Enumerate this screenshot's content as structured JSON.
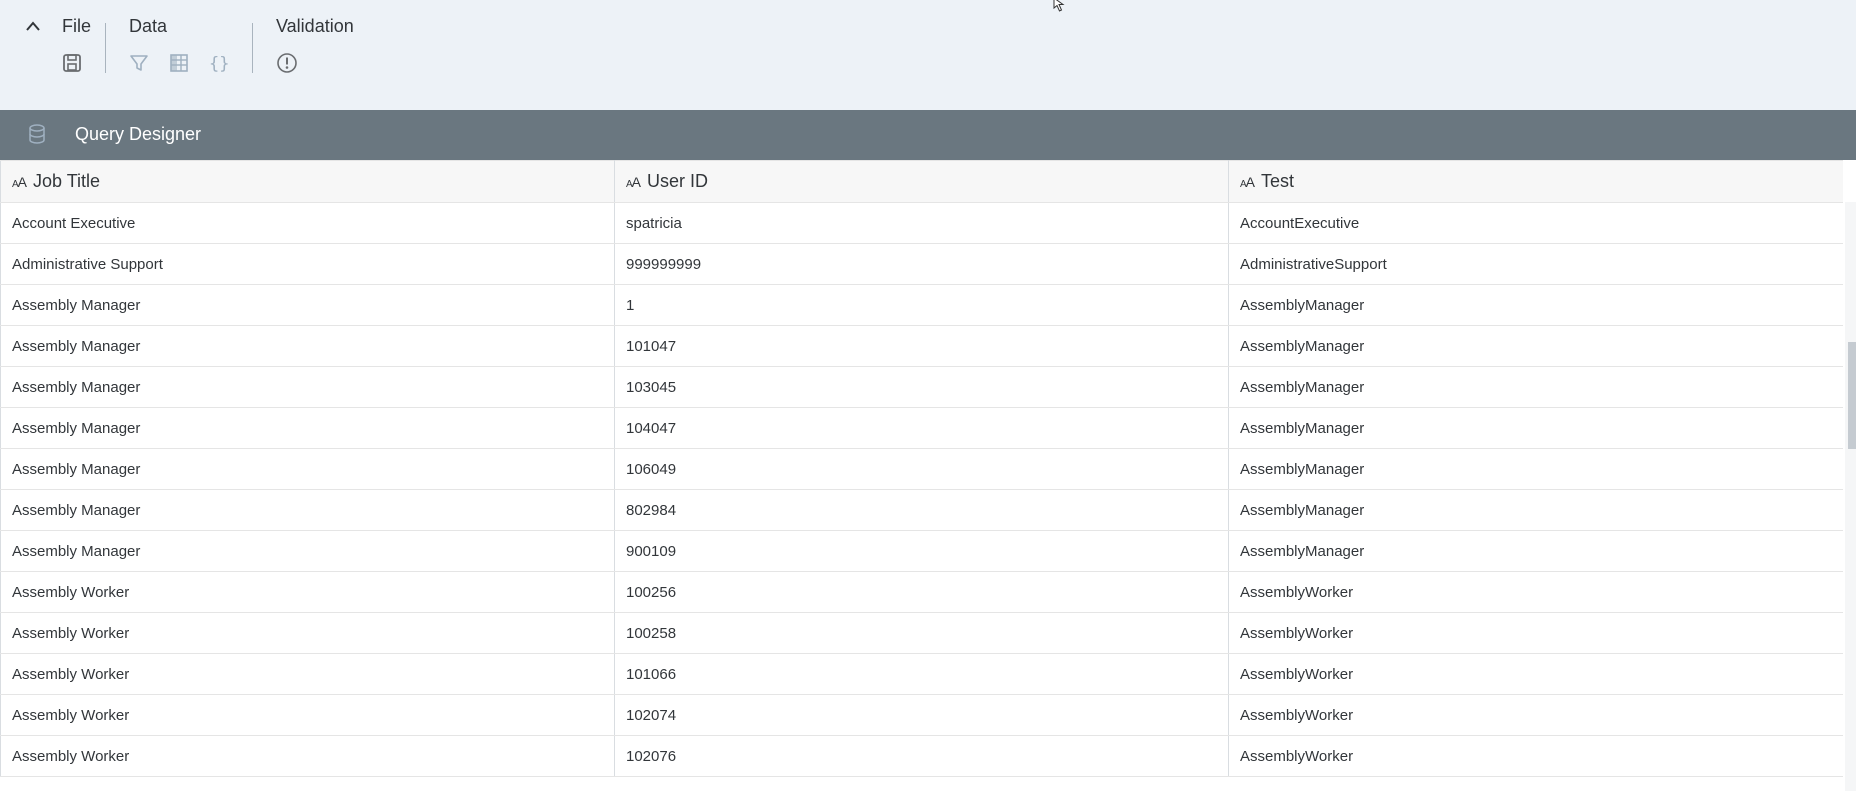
{
  "toolbar": {
    "groups": [
      {
        "title": "File",
        "icons": [
          "save-icon"
        ]
      },
      {
        "title": "Data",
        "icons": [
          "filter-icon",
          "table-view-icon",
          "formula-icon"
        ]
      },
      {
        "title": "Validation",
        "icons": [
          "validation-warning-icon"
        ]
      }
    ],
    "collapse_icon": "chevron-up-icon"
  },
  "panel": {
    "icon": "database-icon",
    "title": "Query Designer"
  },
  "table": {
    "columns": [
      {
        "type_icon": "text-type-icon",
        "label": "Job Title"
      },
      {
        "type_icon": "text-type-icon",
        "label": "User ID"
      },
      {
        "type_icon": "text-type-icon",
        "label": "Test"
      }
    ],
    "rows": [
      [
        "Account Executive",
        "spatricia",
        "AccountExecutive"
      ],
      [
        "Administrative Support",
        "999999999",
        "AdministrativeSupport"
      ],
      [
        "Assembly Manager",
        "1",
        "AssemblyManager"
      ],
      [
        "Assembly Manager",
        "101047",
        "AssemblyManager"
      ],
      [
        "Assembly Manager",
        "103045",
        "AssemblyManager"
      ],
      [
        "Assembly Manager",
        "104047",
        "AssemblyManager"
      ],
      [
        "Assembly Manager",
        "106049",
        "AssemblyManager"
      ],
      [
        "Assembly Manager",
        "802984",
        "AssemblyManager"
      ],
      [
        "Assembly Manager",
        "900109",
        "AssemblyManager"
      ],
      [
        "Assembly Worker",
        "100256",
        "AssemblyWorker"
      ],
      [
        "Assembly Worker",
        "100258",
        "AssemblyWorker"
      ],
      [
        "Assembly Worker",
        "101066",
        "AssemblyWorker"
      ],
      [
        "Assembly Worker",
        "102074",
        "AssemblyWorker"
      ],
      [
        "Assembly Worker",
        "102076",
        "AssemblyWorker"
      ]
    ]
  },
  "colors": {
    "toolbar_bg": "#edf2f7",
    "panel_header_bg": "#6a7780",
    "icon_color": "#6a6d70",
    "disabled_icon_color": "#9fb0c0"
  }
}
